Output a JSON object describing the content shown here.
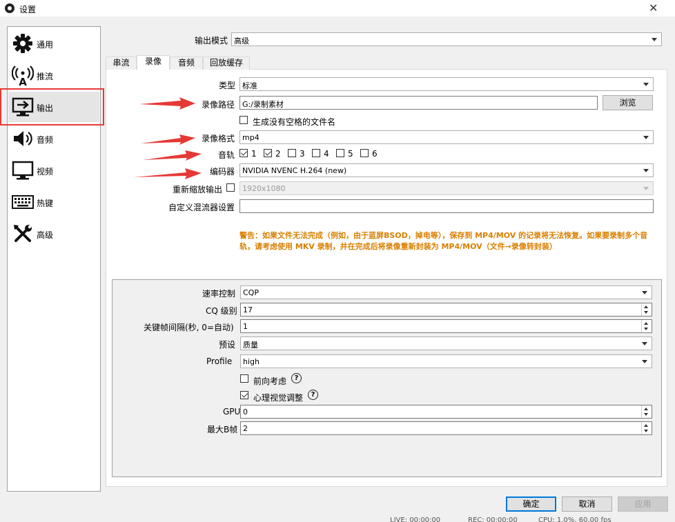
{
  "window": {
    "title": "设置"
  },
  "sidebar": {
    "items": [
      {
        "label": "通用",
        "icon": "gear-icon"
      },
      {
        "label": "推流",
        "icon": "broadcast-icon"
      },
      {
        "label": "输出",
        "icon": "output-icon",
        "selected": true
      },
      {
        "label": "音频",
        "icon": "speaker-icon"
      },
      {
        "label": "视频",
        "icon": "monitor-icon"
      },
      {
        "label": "热键",
        "icon": "keyboard-icon"
      },
      {
        "label": "高级",
        "icon": "tools-icon"
      }
    ]
  },
  "output_mode": {
    "label": "输出模式",
    "value": "高级"
  },
  "tabs": [
    {
      "label": "串流"
    },
    {
      "label": "录像",
      "active": true
    },
    {
      "label": "音频"
    },
    {
      "label": "回放缓存"
    }
  ],
  "recording": {
    "type": {
      "label": "类型",
      "value": "标准"
    },
    "path": {
      "label": "录像路径",
      "value": "G:/录制素材",
      "browse": "浏览"
    },
    "no_space": {
      "label": "生成没有空格的文件名",
      "checked": false
    },
    "format": {
      "label": "录像格式",
      "value": "mp4"
    },
    "tracks": {
      "label": "音轨",
      "items": [
        {
          "label": "1",
          "checked": true
        },
        {
          "label": "2",
          "checked": true
        },
        {
          "label": "3",
          "checked": false
        },
        {
          "label": "4",
          "checked": false
        },
        {
          "label": "5",
          "checked": false
        },
        {
          "label": "6",
          "checked": false
        }
      ]
    },
    "encoder": {
      "label": "编码器",
      "value": "NVIDIA NVENC H.264 (new)"
    },
    "rescale": {
      "label": "重新缩放输出",
      "checked": false,
      "value": "1920x1080"
    },
    "muxer": {
      "label": "自定义混流器设置",
      "value": ""
    },
    "warning": "警告：如果文件无法完成（例如，由于蓝屏BSOD，掉电等），保存到 MP4/MOV 的记录将无法恢复。如果要录制多个音轨，请考虑使用 MKV 录制，并在完成后将录像重新封装为 MP4/MOV（文件→录像转封装）"
  },
  "encoder_settings": {
    "rate_control": {
      "label": "速率控制",
      "value": "CQP"
    },
    "cq_level": {
      "label": "CQ 级别",
      "value": "17"
    },
    "keyframe": {
      "label": "关键帧间隔(秒, 0=自动)",
      "value": "1"
    },
    "preset": {
      "label": "预设",
      "value": "质量"
    },
    "profile": {
      "label": "Profile",
      "value": "high"
    },
    "lookahead": {
      "label": "前向考虑",
      "checked": false
    },
    "psycho": {
      "label": "心理视觉调整",
      "checked": true
    },
    "gpu": {
      "label": "GPU",
      "value": "0"
    },
    "bframes": {
      "label": "最大B帧",
      "value": "2"
    }
  },
  "buttons": {
    "ok": "确定",
    "cancel": "取消",
    "apply": "应用"
  },
  "statusbar": {
    "live": "LIVE: 00:00:00",
    "rec": "REC: 00:00:00",
    "cpu": "CPU: 1.0%, 60.00 fps"
  },
  "colors": {
    "arrow": "#e53935",
    "highlight": "#e53935",
    "warning": "#d97f00",
    "accent": "#0078d7"
  }
}
